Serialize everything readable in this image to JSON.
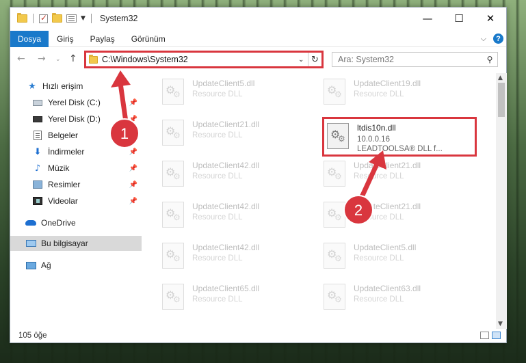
{
  "window": {
    "title": "System32"
  },
  "titlebar": {
    "minimize": "—",
    "maximize": "☐",
    "close": "✕"
  },
  "ribbon": {
    "tabs": [
      "Dosya",
      "Giriş",
      "Paylaş",
      "Görünüm"
    ]
  },
  "address": {
    "path": "C:\\Windows\\System32"
  },
  "search": {
    "placeholder": "Ara: System32"
  },
  "sidebar": {
    "items": [
      {
        "label": "Hızlı erişim",
        "icon": "star-icon"
      },
      {
        "label": "Yerel Disk (C:)",
        "icon": "drive-icon",
        "pinned": true
      },
      {
        "label": "Yerel Disk (D:)",
        "icon": "drive-icon",
        "pinned": true
      },
      {
        "label": "Belgeler",
        "icon": "documents-icon",
        "pinned": true
      },
      {
        "label": "İndirmeler",
        "icon": "downloads-icon",
        "pinned": true
      },
      {
        "label": "Müzik",
        "icon": "music-icon",
        "pinned": true
      },
      {
        "label": "Resimler",
        "icon": "pictures-icon",
        "pinned": true
      },
      {
        "label": "Videolar",
        "icon": "videos-icon",
        "pinned": true
      },
      {
        "label": "OneDrive",
        "icon": "onedrive-icon"
      },
      {
        "label": "Bu bilgisayar",
        "icon": "this-pc-icon",
        "selected": true
      },
      {
        "label": "Ağ",
        "icon": "network-icon"
      }
    ]
  },
  "files": {
    "left": [
      {
        "name": "UpdateClient5.dll",
        "desc": "Resource DLL"
      },
      {
        "name": "UpdateClient21.dll",
        "desc": "Resource DLL"
      },
      {
        "name": "UpdateClient42.dll",
        "desc": "Resource DLL"
      },
      {
        "name": "UpdateClient42.dll",
        "desc": "Resource DLL"
      },
      {
        "name": "UpdateClient42.dll",
        "desc": "Resource DLL"
      },
      {
        "name": "UpdateClient65.dll",
        "desc": "Resource DLL"
      }
    ],
    "right": [
      {
        "name": "UpdateClient19.dll",
        "desc": "Resource DLL"
      },
      {
        "name": "UpdateClient21.dll",
        "desc": "Resource DLL"
      },
      {
        "name": "UpdateClient21.dll",
        "desc": "Resource DLL"
      },
      {
        "name": "UpdateClient5.dll",
        "desc": "Resource DLL"
      },
      {
        "name": "UpdateClient63.dll",
        "desc": "Resource DLL"
      }
    ],
    "highlighted": {
      "name": "ltdis10n.dll",
      "version": "10.0.0.16",
      "desc": "LEADTOOLSA® DLL f..."
    }
  },
  "status": {
    "count": "105 öğe"
  },
  "annotations": {
    "step1": "1",
    "step2": "2",
    "color": "#d9363e"
  }
}
